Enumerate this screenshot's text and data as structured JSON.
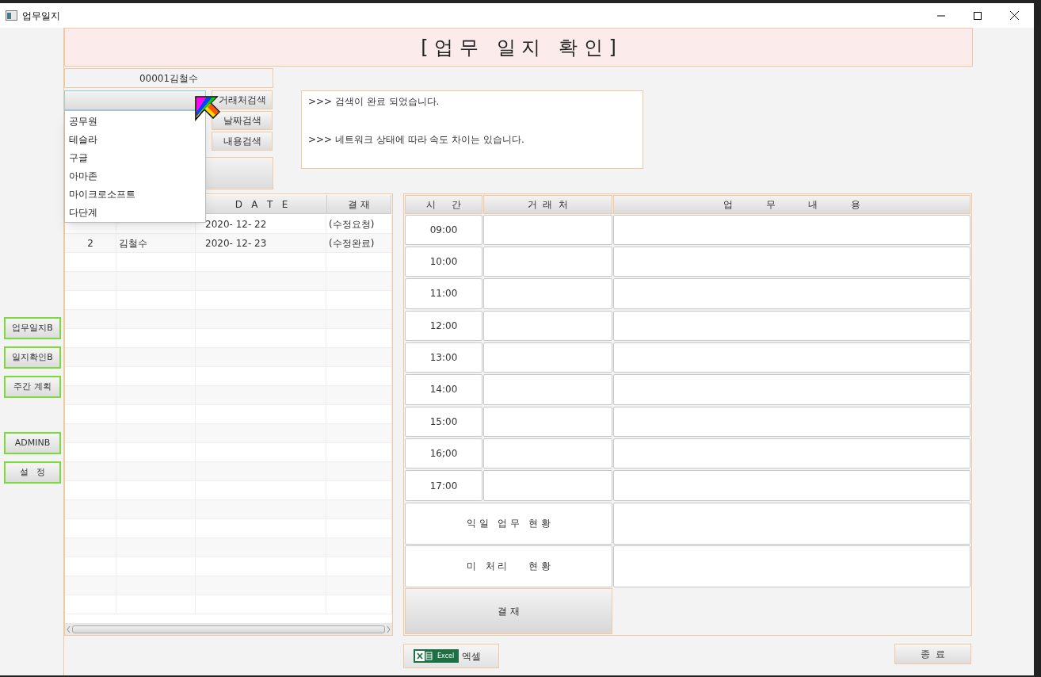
{
  "window": {
    "title": "업무일지"
  },
  "sidebar": {
    "groups": [
      [
        "업무일지B",
        "일지확인B",
        "주간 계획"
      ],
      [
        "ADMINB",
        "설   정"
      ]
    ]
  },
  "header": {
    "title": "[ 업 무   일 지   확 인 ]"
  },
  "user_label": "00001김철수",
  "company_combo": {
    "expanded": true,
    "options": [
      "공무원",
      "테슬라",
      "구글",
      "아마존",
      "마이크로소프트",
      "다단계"
    ]
  },
  "search_buttons": [
    "거래처검색",
    "날짜검색",
    "내용검색"
  ],
  "messages": [
    ">>> 검색이 완료 되었습니다.",
    ">>> 네트워크 상태에 따라 속도 차이는 있습니다."
  ],
  "log_table": {
    "columns": [
      "D   A   T   E",
      "결 재"
    ],
    "rows": [
      {
        "date": "2020- 12- 22",
        "status": "(수정요청)"
      },
      {
        "no": "2",
        "name": "김철수",
        "date": "2020- 12- 23",
        "status": "(수정완료)"
      }
    ]
  },
  "schedule": {
    "columns": [
      "시     간",
      "거  래  처",
      "업           무           내           용"
    ],
    "times": [
      "09:00",
      "10:00",
      "11:00",
      "12:00",
      "13:00",
      "14:00",
      "15:00",
      "16;00",
      "17:00"
    ],
    "summary_rows": [
      "익 일   업 무   현 황",
      "미   처 리       현 황"
    ],
    "approve_button": "결 재"
  },
  "footer": {
    "excel_logo": "Excel",
    "excel_button": "엑셀",
    "close_button": "종  료"
  }
}
